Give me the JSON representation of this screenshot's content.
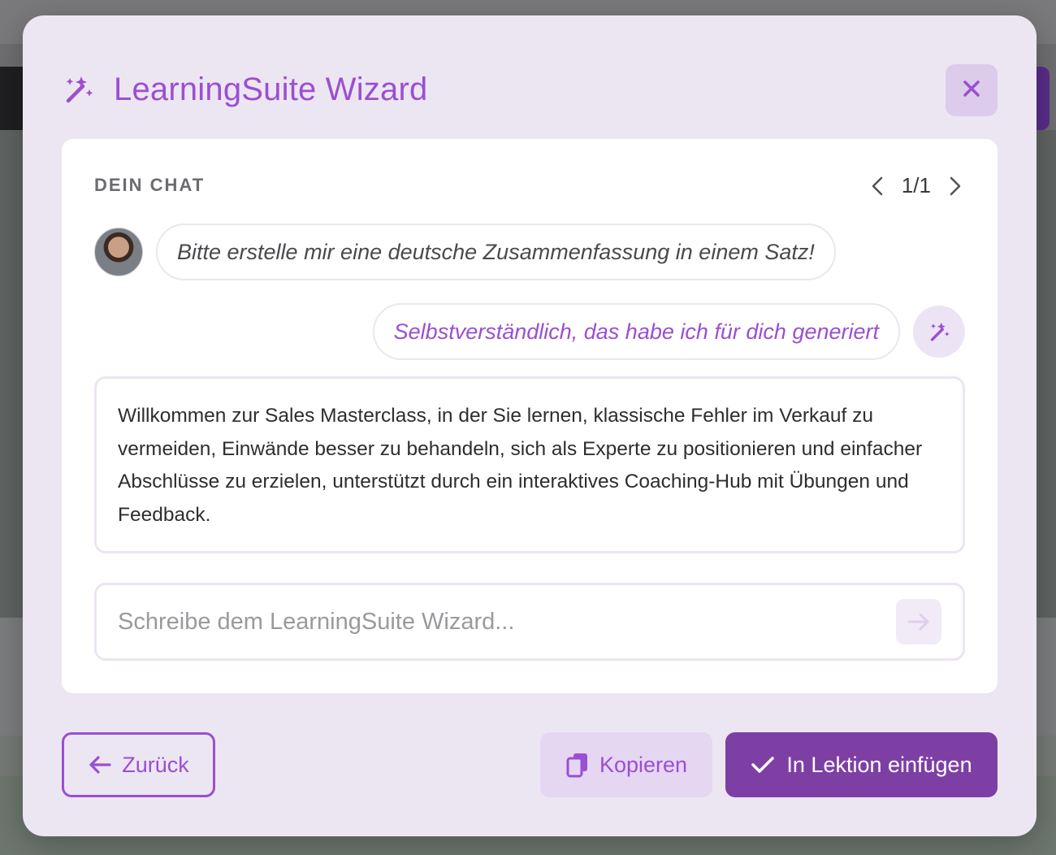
{
  "modal": {
    "title": "LearningSuite Wizard",
    "close_icon": "close-icon",
    "title_icon": "magic-wand-icon"
  },
  "chat": {
    "label": "DEIN CHAT",
    "pager": {
      "count": "1/1",
      "prev_icon": "chevron-left-icon",
      "next_icon": "chevron-right-icon"
    },
    "user_message": "Bitte erstelle mir eine deutsche Zusammenfassung in einem Satz!",
    "bot_message": "Selbstverständlich, das habe ich für dich generiert",
    "answer": "Willkommen zur Sales Masterclass, in der Sie lernen, klassische Fehler im Verkauf zu vermeiden, Einwände besser zu behandeln, sich als Experte zu positionieren und einfacher Abschlüsse zu erzielen, unterstützt durch ein interaktives Coaching-Hub mit Übungen und Feedback.",
    "input": {
      "placeholder": "Schreibe dem LearningSuite Wizard...",
      "value": ""
    }
  },
  "footer": {
    "back_label": "Zurück",
    "copy_label": "Kopieren",
    "insert_label": "In Lektion einfügen"
  },
  "colors": {
    "accent": "#9b4fd1",
    "primary_button": "#7e3fa4",
    "modal_bg": "#ece6f3"
  }
}
